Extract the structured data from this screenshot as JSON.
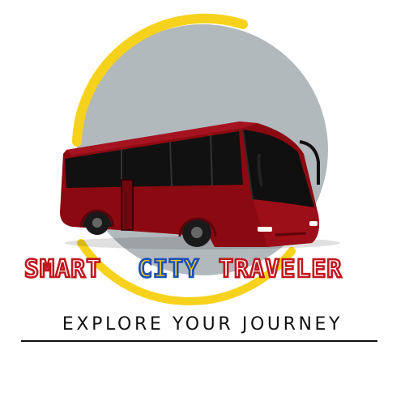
{
  "brand": {
    "title_word_1": "SMART",
    "title_word_2": "CITY",
    "title_word_3": "TRAVELER",
    "tagline": "EXPLORE YOUR JOURNEY"
  },
  "colors": {
    "circle": "#b2b9bd",
    "ring": "#f7d21c",
    "bus_body": "#8b0a12",
    "window": "#111111",
    "title_red": "#c0171f",
    "title_blue": "#1f4fb5",
    "title_yellow": "#f7d21c"
  },
  "icons": {
    "bus": "bus-icon"
  }
}
